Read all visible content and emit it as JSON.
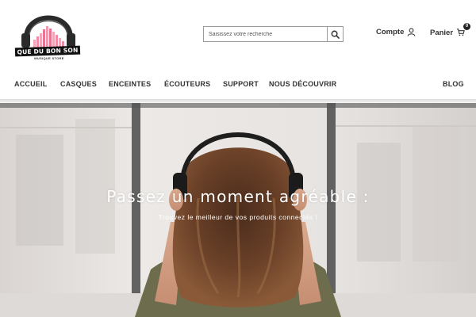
{
  "brand": {
    "logo_text": "QUE DU BON SON",
    "logo_subtitle": "MUSIQUE STORE"
  },
  "search": {
    "placeholder": "Saisissez votre recherche",
    "icon": "search-icon"
  },
  "header": {
    "account_label": "Compte",
    "account_icon": "user-icon",
    "cart_label": "Panier",
    "cart_icon": "cart-icon",
    "cart_count": "0"
  },
  "nav": {
    "items": [
      {
        "label": "ACCUEIL"
      },
      {
        "label": "CASQUES"
      },
      {
        "label": "ENCEINTES"
      },
      {
        "label": "ÉCOUTEURS"
      },
      {
        "label": "SUPPORT"
      },
      {
        "label": "NOUS DÉCOUVRIR"
      },
      {
        "label": "BLOG"
      }
    ]
  },
  "hero": {
    "title": "Passez un moment agréable :",
    "subtitle": "Trouvez le meilleur de vos produits connectés !"
  },
  "colors": {
    "text": "#333333",
    "hero_text": "#ffffff",
    "badge": "#222222"
  }
}
